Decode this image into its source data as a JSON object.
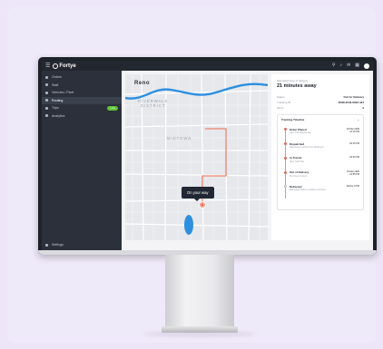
{
  "app": {
    "brand": "Fortye",
    "top_icons": [
      "search-icon",
      "bell-icon",
      "mail-icon",
      "grid-icon",
      "user-avatar"
    ]
  },
  "sidebar": {
    "items": [
      {
        "label": "Orders",
        "icon": "orders-icon",
        "active": false
      },
      {
        "label": "Staff",
        "icon": "staff-icon",
        "active": false
      },
      {
        "label": "Vehicles / Fleet",
        "icon": "truck-icon",
        "active": false
      },
      {
        "label": "Routing",
        "icon": "routing-icon",
        "active": true
      },
      {
        "label": "Trips",
        "icon": "trips-icon",
        "active": false,
        "badge": "Live"
      },
      {
        "label": "Analytics",
        "icon": "analytics-icon",
        "active": false
      }
    ],
    "footer": "Settings"
  },
  "map": {
    "city": "Reno",
    "district_line1": "RIVERWALK",
    "district_line2": "DISTRICT",
    "area": "MIDTOWN",
    "tooltip": "On your way"
  },
  "delivery": {
    "eta_label": "Estimated time of delivery",
    "eta_value": "21 minutes away",
    "status_label": "Status",
    "status_value": "Out for Delivery",
    "tracking_label": "Tracking ID",
    "tracking_value": "DXW-2043-0022-444",
    "items_label": "Items",
    "items_value": "2"
  },
  "timeline": {
    "title": "Tracking Timeline",
    "steps": [
      {
        "title": "Order Placed",
        "sub": "New York Warehouse",
        "date": "18 Mar 2025",
        "time": "12:15 PM",
        "done": true
      },
      {
        "title": "Dispatched",
        "sub": "Warehouse pickup from Shipment",
        "date": "",
        "time": "02:15 PM",
        "done": true
      },
      {
        "title": "In Transit",
        "sub": "New York Hub",
        "date": "",
        "time": "03:30 PM",
        "done": true
      },
      {
        "title": "Out of Delivery",
        "sub": "By Driver in Reno",
        "date": "19 Mar 2025",
        "time": "12:55 PM",
        "done": true
      },
      {
        "title": "Delivered",
        "sub": "Estimated Delivery address location",
        "date": "",
        "time": "Before 6 PM",
        "done": false
      }
    ]
  },
  "colors": {
    "accent": "#e06a55",
    "route": "#ef6a4f",
    "river": "#2d8fe0",
    "live_badge": "#5bc236"
  }
}
